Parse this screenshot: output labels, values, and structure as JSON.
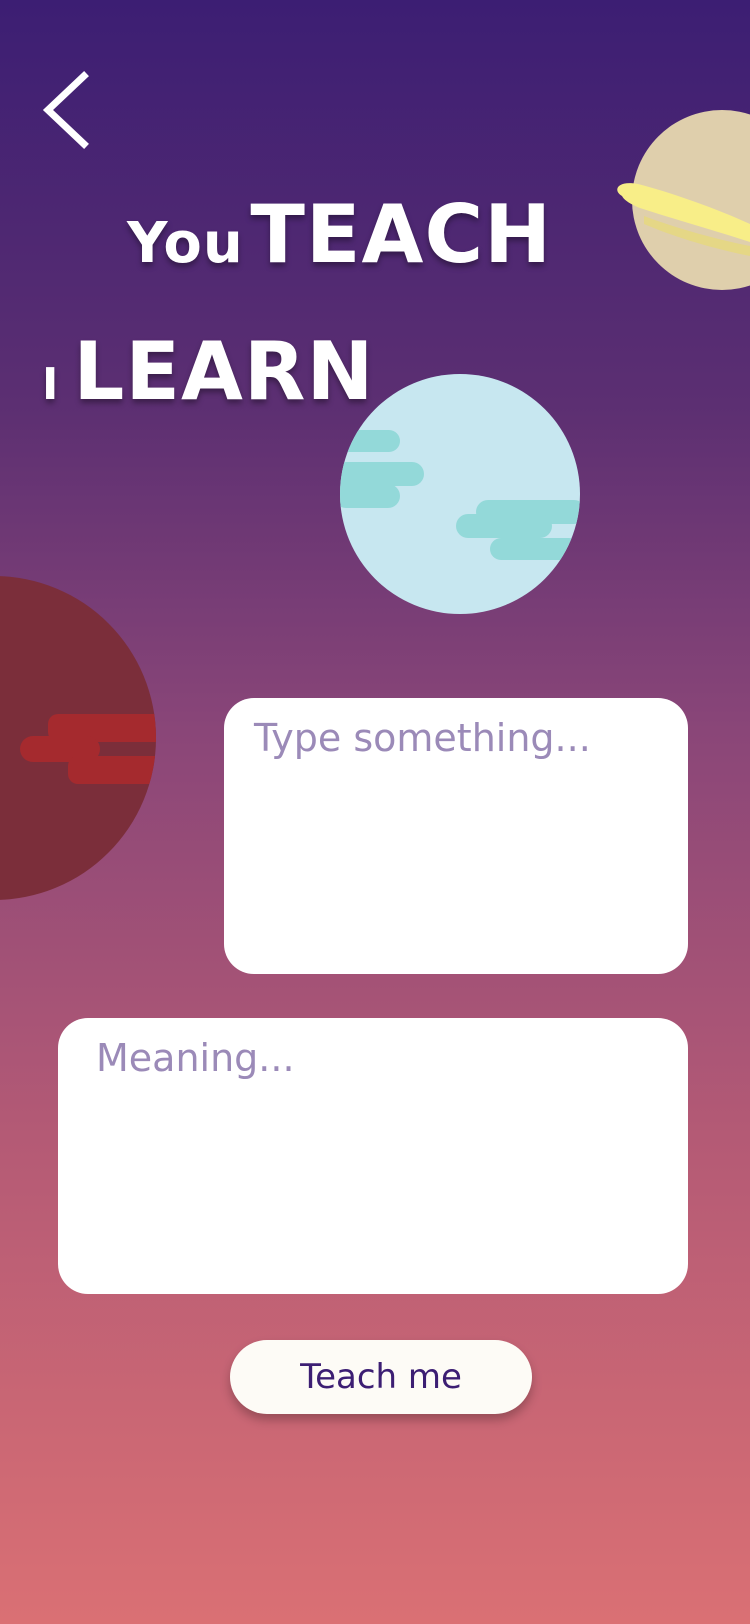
{
  "header": {
    "title_line1_small": "You",
    "title_line1_big": "TEACH",
    "title_line2_small": "I",
    "title_line2_big": "LEARN"
  },
  "icons": {
    "back": "chevron-left-icon"
  },
  "form": {
    "phrase_placeholder": "Type something...",
    "meaning_placeholder": "Meaning..."
  },
  "actions": {
    "submit_label": "Teach me"
  },
  "colors": {
    "gradient_top": "#3c1e73",
    "gradient_bottom": "#da7074",
    "button_text": "#3c1e73",
    "placeholder": "#9b8ab8",
    "blue_planet": "#c7e7f0",
    "blue_planet_clouds": "#93d9d9",
    "red_planet": "#7b2e3a",
    "red_planet_stripe": "#a52a2e",
    "saturn_body": "#dfcfac",
    "saturn_ring": "#f8ee88"
  }
}
